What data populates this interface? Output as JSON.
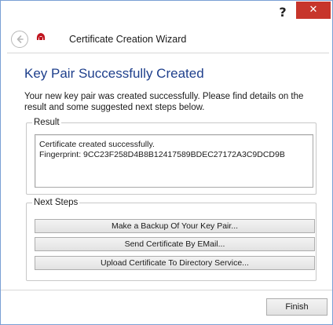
{
  "titlebar": {
    "help_label": "?",
    "close_label": "✕",
    "close_color": "#c7352b"
  },
  "header": {
    "title": "Certificate Creation Wizard",
    "back_icon": "back-arrow-icon",
    "app_icon": "app-logo-icon"
  },
  "main": {
    "heading": "Key Pair Successfully Created",
    "intro": "Your new key pair was created successfully. Please find details on the result and some suggested next steps below.",
    "result": {
      "legend": "Result",
      "line1": "Certificate created successfully.",
      "line2": "Fingerprint: 9CC23F258D4B8B12417589BDEC27172A3C9DCD9B"
    },
    "next_steps": {
      "legend": "Next Steps",
      "buttons": [
        "Make a Backup Of Your Key Pair...",
        "Send Certificate By EMail...",
        "Upload Certificate To Directory Service..."
      ]
    }
  },
  "footer": {
    "finish_label": "Finish"
  },
  "colors": {
    "heading": "#1e3f8c",
    "accent_border": "#7a9fd4",
    "app_icon": "#c0141e"
  }
}
